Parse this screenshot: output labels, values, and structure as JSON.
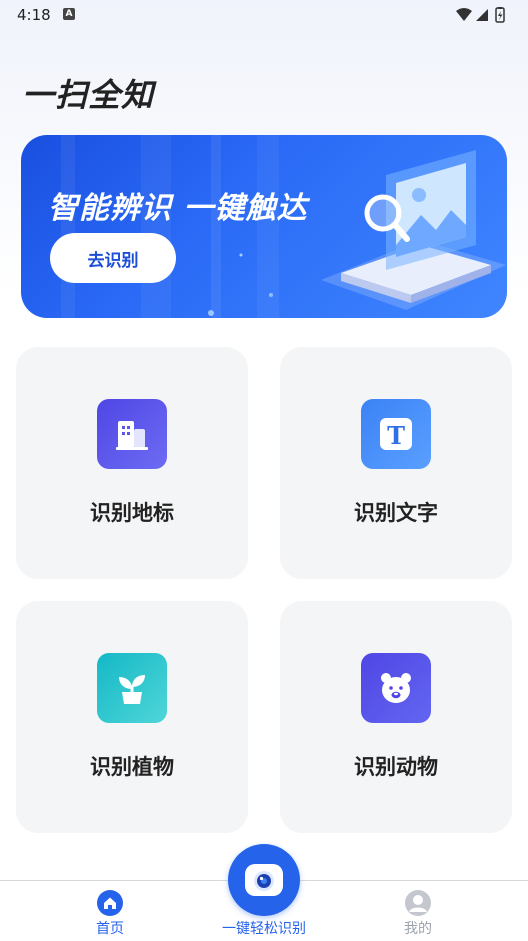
{
  "status_bar": {
    "time": "4:18",
    "notification_letter": "A"
  },
  "header": {
    "title": "一扫全知"
  },
  "banner": {
    "slogan": "智能辨识 一键触达",
    "button_label": "去识别"
  },
  "cards": [
    {
      "label": "识别地标",
      "icon": "building-icon"
    },
    {
      "label": "识别文字",
      "icon": "text-t-icon"
    },
    {
      "label": "识别植物",
      "icon": "plant-icon"
    },
    {
      "label": "识别动物",
      "icon": "bear-icon"
    }
  ],
  "tabbar": {
    "home_label": "首页",
    "scan_label": "一键轻松识别",
    "mine_label": "我的",
    "active_color": "#2563eb",
    "inactive_color": "#9ca3af"
  }
}
